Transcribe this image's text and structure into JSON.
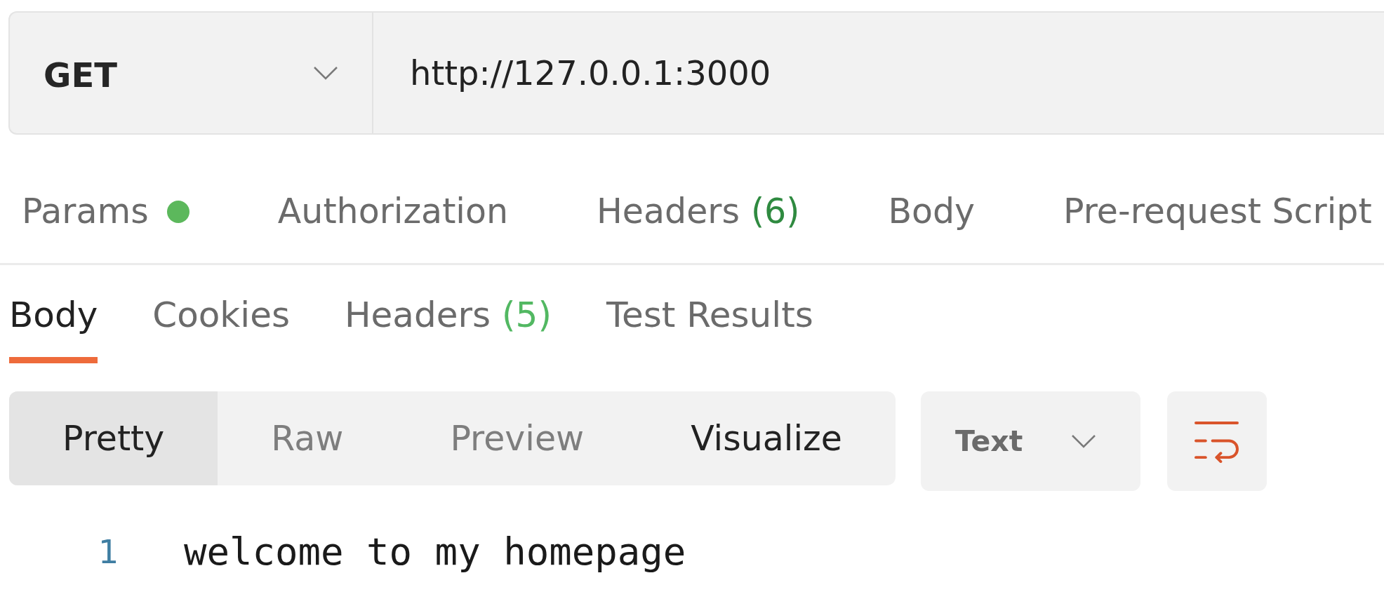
{
  "request": {
    "method": "GET",
    "url": "http://127.0.0.1:3000"
  },
  "request_tabs": [
    {
      "label": "Params",
      "indicator": true,
      "selected": false
    },
    {
      "label": "Authorization",
      "indicator": false,
      "selected": false
    },
    {
      "label": "Headers",
      "count": "(6)",
      "indicator": false,
      "selected": false
    },
    {
      "label": "Body",
      "indicator": false,
      "selected": false
    },
    {
      "label": "Pre-request Script",
      "indicator": false,
      "selected": false
    }
  ],
  "response_tabs": [
    {
      "label": "Body",
      "selected": true
    },
    {
      "label": "Cookies",
      "selected": false
    },
    {
      "label": "Headers",
      "count": "(5)",
      "selected": false
    },
    {
      "label": "Test Results",
      "selected": false
    }
  ],
  "view_modes": [
    {
      "label": "Pretty",
      "selected": true,
      "dimmed": false
    },
    {
      "label": "Raw",
      "selected": false,
      "dimmed": true
    },
    {
      "label": "Preview",
      "selected": false,
      "dimmed": true
    },
    {
      "label": "Visualize",
      "selected": false,
      "dimmed": false
    }
  ],
  "format_dropdown": {
    "value": "Text"
  },
  "wrap_toggle": {
    "on": true
  },
  "response_body": {
    "lines": [
      {
        "number": "1",
        "text": "welcome to my homepage"
      }
    ]
  }
}
